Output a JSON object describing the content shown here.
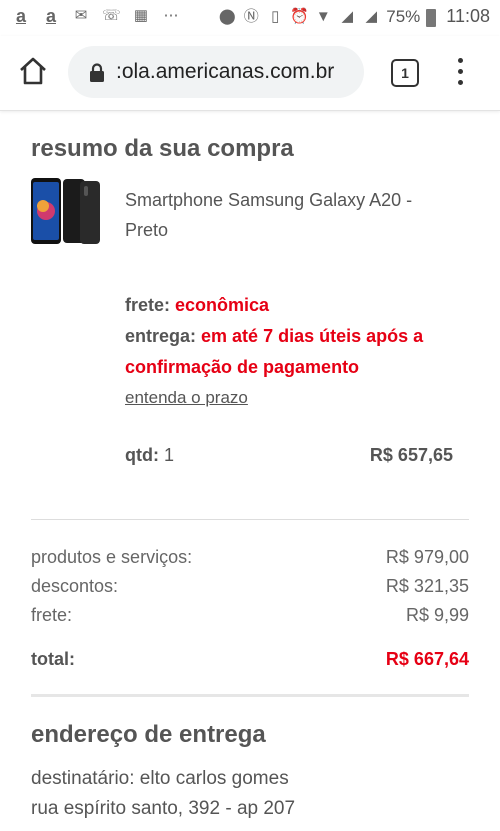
{
  "status_bar": {
    "battery": "75%",
    "time": "11:08",
    "more": "⋯"
  },
  "browser": {
    "url": ":ola.americanas.com.br",
    "tab_count": "1"
  },
  "purchase_summary": {
    "title": "resumo da sua compra",
    "product_name": "Smartphone Samsung Galaxy A20 - Preto",
    "freight_label": "frete:",
    "freight_value": "econômica",
    "delivery_label": "entrega:",
    "delivery_value": "em até 7 dias úteis após a confirmação de pagamento",
    "deadline_link": "entenda o prazo",
    "qty_label": "qtd:",
    "qty_value": "1",
    "item_price": "R$ 657,65"
  },
  "totals": {
    "products_label": "produtos e serviços:",
    "products_value": "R$ 979,00",
    "discounts_label": "descontos:",
    "discounts_value": "R$ 321,35",
    "freight_label": "frete:",
    "freight_value": "R$ 9,99",
    "total_label": "total:",
    "total_value": "R$ 667,64"
  },
  "delivery_address": {
    "title": "endereço de entrega",
    "recipient": "destinatário: elto carlos gomes",
    "street": "rua espírito santo, 392 - ap 207"
  },
  "colors": {
    "accent_red": "#e60014",
    "text_gray": "#555555"
  }
}
